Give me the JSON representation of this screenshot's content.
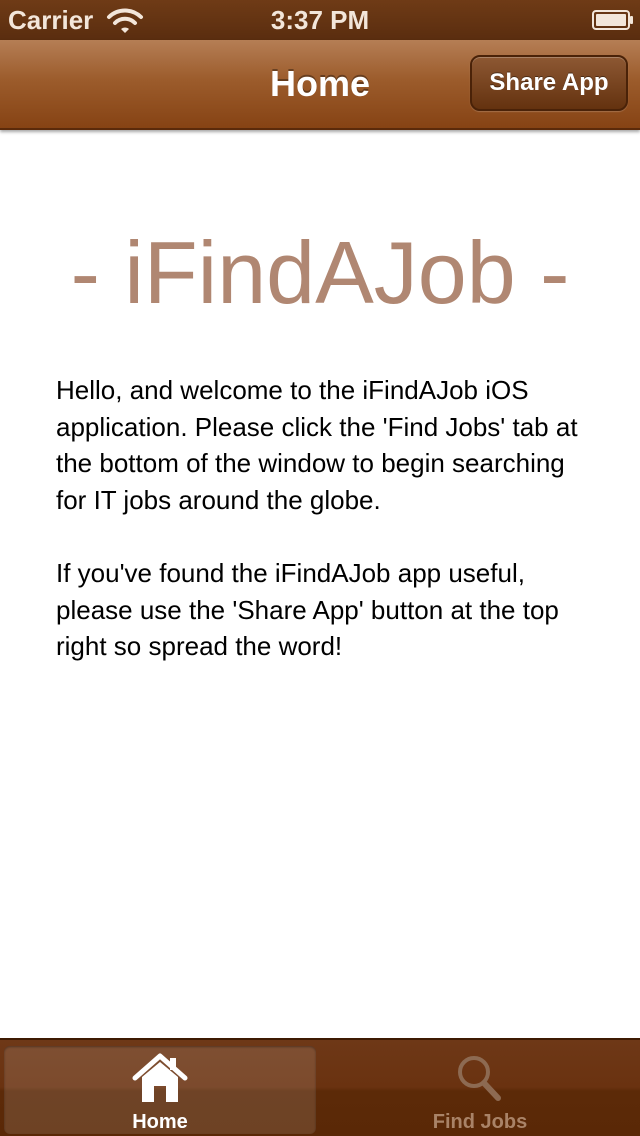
{
  "status_bar": {
    "carrier": "Carrier",
    "time": "3:37 PM",
    "wifi_icon": "wifi-icon",
    "battery_icon": "battery-icon"
  },
  "nav_bar": {
    "title": "Home",
    "share_button_label": "Share App"
  },
  "content": {
    "heading": "- iFindAJob -",
    "paragraphs": [
      "Hello, and welcome to the iFindAJob iOS application. Please click the 'Find Jobs' tab at the bottom of the window to begin searching for IT jobs around the globe.",
      "If you've found the iFindAJob app useful, please use the 'Share App' button at the top right so spread the word!"
    ]
  },
  "tab_bar": {
    "tabs": [
      {
        "label": "Home",
        "icon": "home-icon",
        "selected": true
      },
      {
        "label": "Find Jobs",
        "icon": "magnifier-icon",
        "selected": false
      }
    ]
  },
  "colors": {
    "brand_brown": "#864314",
    "heading_color": "#b08772",
    "tab_bar": "#5a2806"
  }
}
